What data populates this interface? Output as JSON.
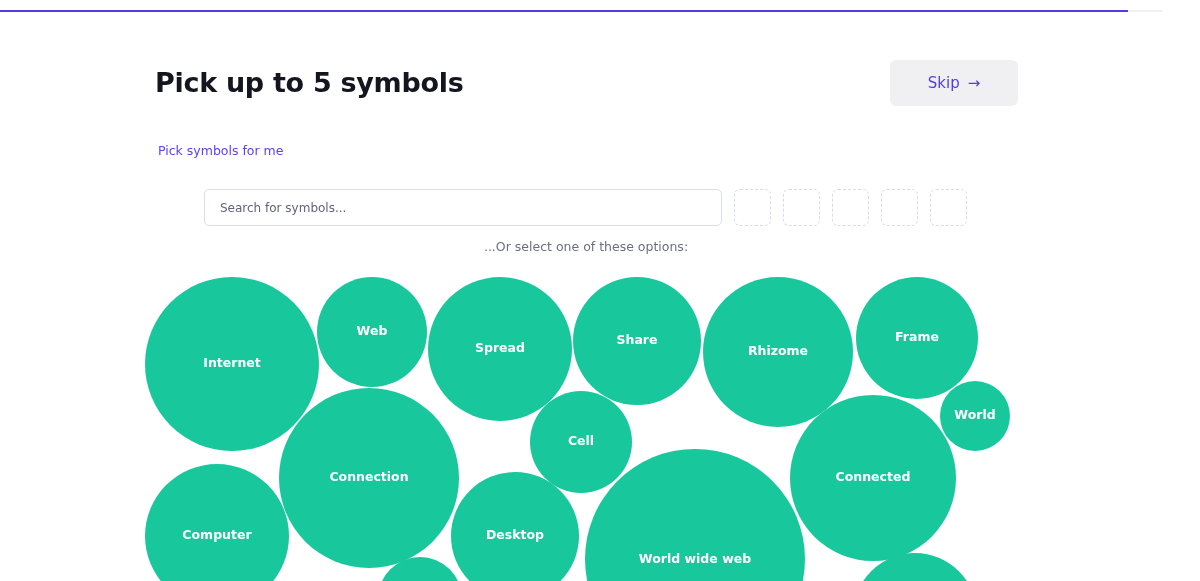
{
  "progress": {
    "level": 0.97
  },
  "title": "Pick up to 5 symbols",
  "skip_button": {
    "label": "Skip",
    "icon": "→"
  },
  "auto_pick_link": "Pick symbols for me",
  "search": {
    "placeholder": "Search for symbols..."
  },
  "slots": [
    {
      "filled": false
    },
    {
      "filled": false
    },
    {
      "filled": false
    },
    {
      "filled": false
    },
    {
      "filled": false
    }
  ],
  "options_hint": "...Or select one of these options:",
  "options": [
    {
      "label": "Internet",
      "selected": false
    },
    {
      "label": "Web",
      "selected": false
    },
    {
      "label": "Spread",
      "selected": false
    },
    {
      "label": "Share",
      "selected": false
    },
    {
      "label": "Rhizome",
      "selected": false
    },
    {
      "label": "Frame",
      "selected": false
    },
    {
      "label": "World",
      "selected": false
    },
    {
      "label": "Cell",
      "selected": false
    },
    {
      "label": "Connection",
      "selected": false
    },
    {
      "label": "Connected",
      "selected": false
    },
    {
      "label": "Computer",
      "selected": false
    },
    {
      "label": "Desktop",
      "selected": false
    },
    {
      "label": "World wide web",
      "selected": false
    }
  ]
}
